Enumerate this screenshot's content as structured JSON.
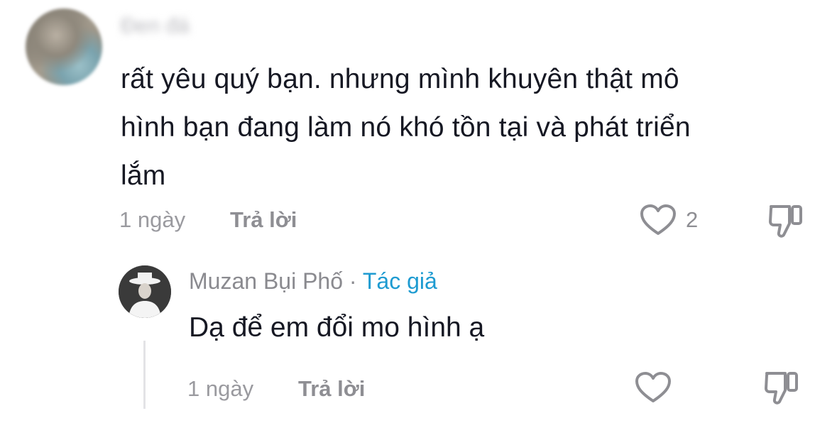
{
  "comment": {
    "username": "Đen đá",
    "text_lines": [
      "rất yêu quý bạn. nhưng mình khuyên thật mô",
      "hình bạn đang làm nó khó tồn tại và phát triển",
      "lắm"
    ],
    "time": "1 ngày",
    "reply_label": "Trả lời",
    "like_count": "2"
  },
  "reply": {
    "username": "Muzan Bụi Phố",
    "separator": "·",
    "author_badge": "Tác giả",
    "text": "Dạ để em đổi mo hình ạ",
    "time": "1 ngày",
    "reply_label": "Trả lời"
  },
  "colors": {
    "text": "#161823",
    "meta": "#9a9a9f",
    "author_badge": "#1e9bd1",
    "icon": "#8e8e93"
  },
  "icons": [
    "heart-icon",
    "dislike-icon"
  ]
}
